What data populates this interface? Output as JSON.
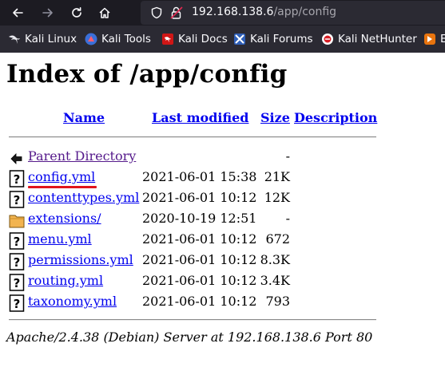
{
  "browser": {
    "url_host": "192.168.138.6",
    "url_path": "/app/config"
  },
  "bookmarks": [
    {
      "label": "Kali Linux",
      "icon": "kali-dragon-icon"
    },
    {
      "label": "Kali Tools",
      "icon": "kali-tools-icon"
    },
    {
      "label": "Kali Docs",
      "icon": "kali-docs-icon"
    },
    {
      "label": "Kali Forums",
      "icon": "kali-forums-icon"
    },
    {
      "label": "Kali NetHunter",
      "icon": "kali-nethunter-icon"
    },
    {
      "label": "E",
      "icon": "exploit-db-icon"
    }
  ],
  "page": {
    "title": "Index of /app/config",
    "columns": {
      "name": "Name",
      "last_modified": "Last modified",
      "size": "Size",
      "description": "Description"
    },
    "parent": {
      "name": "Parent Directory",
      "size": "-"
    },
    "entries": [
      {
        "name": "config.yml",
        "date": "2021-06-01 15:38",
        "size": "21K",
        "icon": "unknown-file-icon"
      },
      {
        "name": "contenttypes.yml",
        "date": "2021-06-01 10:12",
        "size": "12K",
        "icon": "unknown-file-icon"
      },
      {
        "name": "extensions/",
        "date": "2020-10-19 12:51",
        "size": "-",
        "icon": "folder-icon"
      },
      {
        "name": "menu.yml",
        "date": "2021-06-01 10:12",
        "size": "672",
        "icon": "unknown-file-icon"
      },
      {
        "name": "permissions.yml",
        "date": "2021-06-01 10:12",
        "size": "8.3K",
        "icon": "unknown-file-icon"
      },
      {
        "name": "routing.yml",
        "date": "2021-06-01 10:12",
        "size": "3.4K",
        "icon": "unknown-file-icon"
      },
      {
        "name": "taxonomy.yml",
        "date": "2021-06-01 10:12",
        "size": "793",
        "icon": "unknown-file-icon"
      }
    ],
    "footer": "Apache/2.4.38 (Debian) Server at 192.168.138.6 Port 80"
  },
  "colors": {
    "link": "#0000ee",
    "visited": "#551a8b",
    "annotation": "#e0141c",
    "toolbar": "#1c1b22",
    "bookmark_bar": "#2b2a33"
  }
}
